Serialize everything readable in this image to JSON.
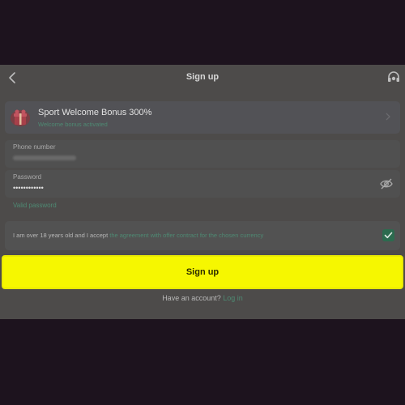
{
  "header": {
    "title": "Sign up",
    "back_icon": "chevron-left-icon",
    "support_icon": "headset-icon"
  },
  "bonus": {
    "title": "Sport Welcome Bonus 300%",
    "subtitle": "Welcome bonus activated",
    "icon": "gift-icon"
  },
  "phone": {
    "label": "Phone number",
    "value": ""
  },
  "password": {
    "label": "Password",
    "value": "••••••••••••",
    "visibility_icon": "eye-off-icon",
    "status": "Valid password"
  },
  "agreement": {
    "text": "I am over 18 years old and I accept",
    "link": "the agreement with offer contract for the chosen currency",
    "checked": true
  },
  "signup_button": {
    "label": "Sign up"
  },
  "login": {
    "prompt": "Have an account?",
    "link": "Log in"
  },
  "colors": {
    "accent": "#f6f700",
    "link": "#4e8a73",
    "overlay": "#1c121d"
  }
}
